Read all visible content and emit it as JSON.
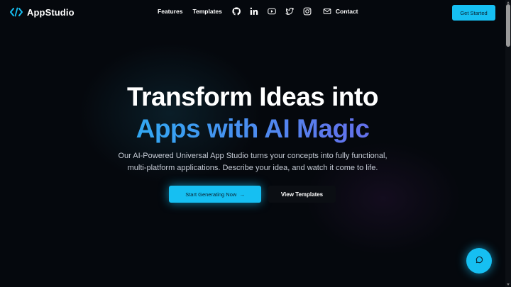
{
  "brand": {
    "name": "AppStudio",
    "logo_icon": "code-brackets-icon",
    "accent_color": "#16bff2"
  },
  "nav": {
    "features": "Features",
    "templates": "Templates",
    "contact": "Contact",
    "social_icons": [
      "github-icon",
      "linkedin-icon",
      "youtube-icon",
      "twitter-icon",
      "instagram-icon"
    ],
    "contact_icon": "mail-icon",
    "cta": "Get Started"
  },
  "hero": {
    "title_line1": "Transform Ideas into",
    "title_line2": "Apps with AI Magic",
    "description_line1": "Our AI-Powered Universal App Studio turns your concepts into fully functional,",
    "description_line2": "multi-platform applications. Describe your idea, and watch it come to life.",
    "primary_button": "Start Generating Now",
    "primary_button_arrow": "→",
    "secondary_button": "View Templates"
  },
  "chat_widget": {
    "icon": "chat-bubble-icon"
  }
}
